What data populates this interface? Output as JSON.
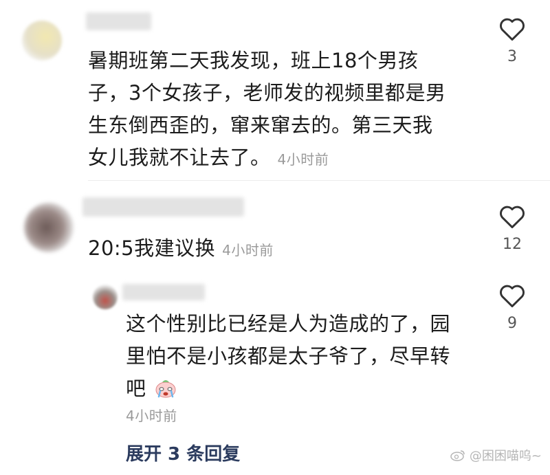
{
  "comments": [
    {
      "text_lines": [
        "暑期班第二天我发现，班上18个男孩",
        "子，3个女孩子，老师发的视频里都是男",
        "生东倒西歪的，窜来窜去的。第三天我",
        "女儿我就不让去了。"
      ],
      "time": "4小时前",
      "likes": "3"
    },
    {
      "text_lines": [
        "20:5我建议换"
      ],
      "time": "4小时前",
      "likes": "12"
    }
  ],
  "reply": {
    "text_lines": [
      "这个性别比已经是人为造成的了，园",
      "里怕不是小孩都是太子爷了，尽早转",
      "吧"
    ],
    "time": "4小时前",
    "likes": "9"
  },
  "expand_label": "展开 3 条回复",
  "watermark": "@困困喵呜~",
  "icons": {
    "like": "heart-outline-icon",
    "emoji": "crying-face-emoji-icon",
    "watermark": "weibo-logo-icon"
  }
}
